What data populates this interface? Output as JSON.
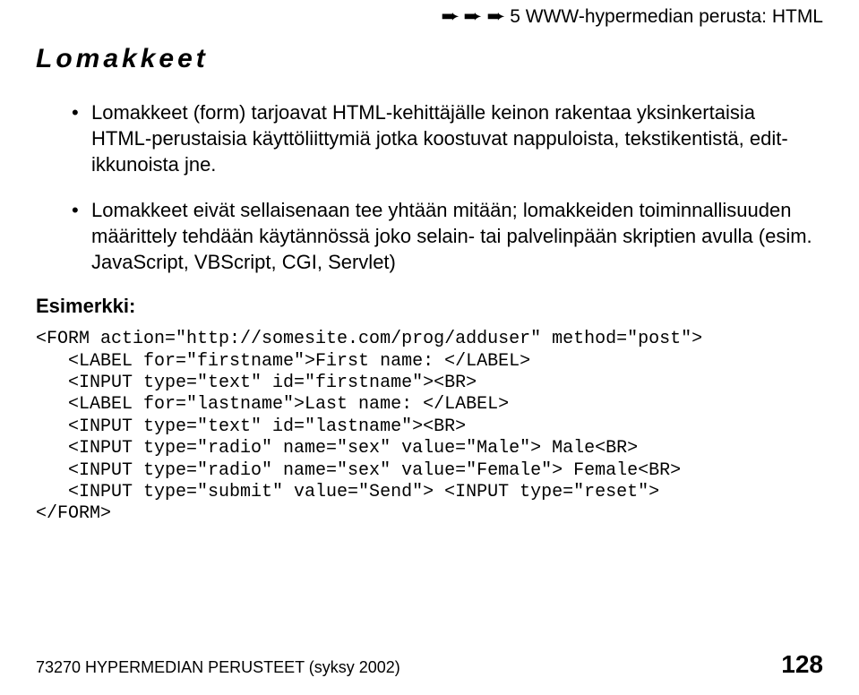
{
  "breadcrumb": {
    "text": "5 WWW-hypermedian perusta: HTML"
  },
  "section_title": "Lomakkeet",
  "bullets": [
    "Lomakkeet (form) tarjoavat HTML-kehittäjälle keinon rakentaa yksinkertaisia HTML-perustaisia käyttöliittymiä jotka koostuvat nappuloista, tekstikentistä, edit-ikkunoista jne.",
    "Lomakkeet eivät sellaisenaan tee yhtään mitään; lomakkeiden toiminnallisuuden määrittely tehdään käytännössä joko selain- tai palvelinpään skriptien avulla (esim. JavaScript, VBScript, CGI, Servlet)"
  ],
  "example_label": "Esimerkki:",
  "code": "<FORM action=\"http://somesite.com/prog/adduser\" method=\"post\">\n   <LABEL for=\"firstname\">First name: </LABEL>\n   <INPUT type=\"text\" id=\"firstname\"><BR>\n   <LABEL for=\"lastname\">Last name: </LABEL>\n   <INPUT type=\"text\" id=\"lastname\"><BR>\n   <INPUT type=\"radio\" name=\"sex\" value=\"Male\"> Male<BR>\n   <INPUT type=\"radio\" name=\"sex\" value=\"Female\"> Female<BR>\n   <INPUT type=\"submit\" value=\"Send\"> <INPUT type=\"reset\">\n</FORM>",
  "footer": {
    "left": "73270 HYPERMEDIAN PERUSTEET (syksy 2002)",
    "page": "128"
  }
}
